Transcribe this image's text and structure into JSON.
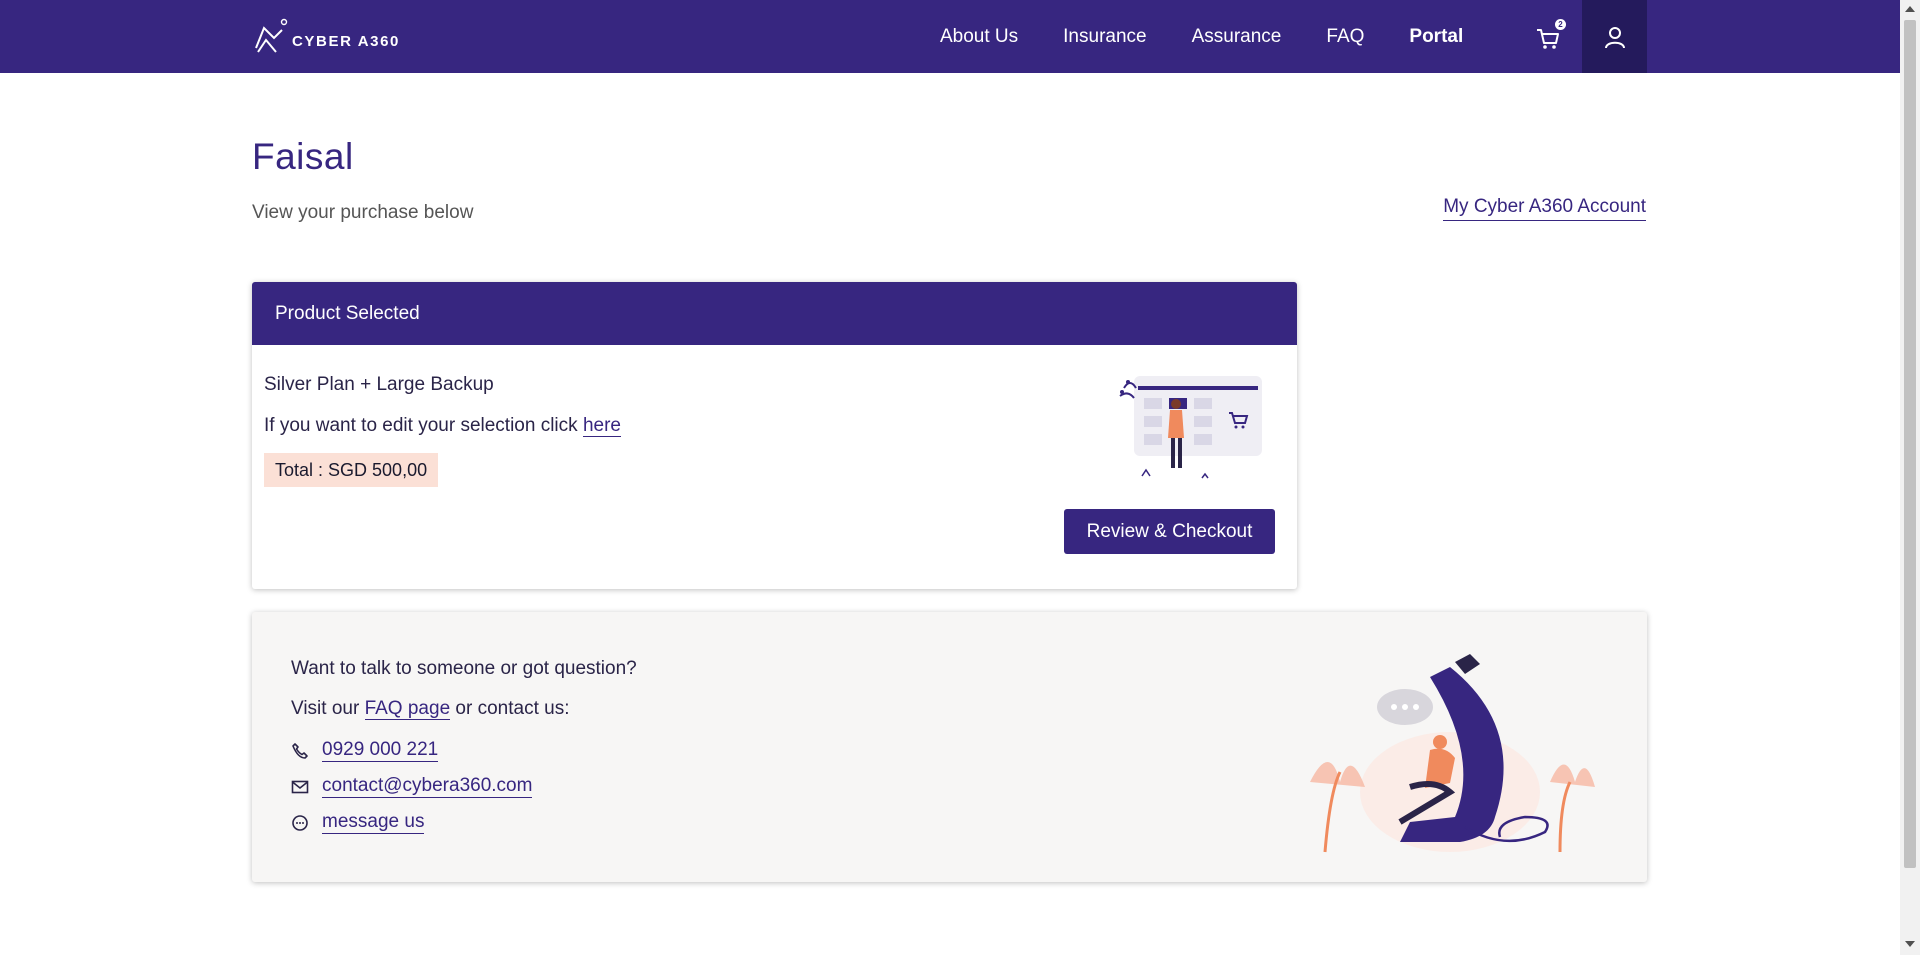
{
  "brand": {
    "name": "CYBER A360",
    "primary_color": "#372680",
    "accent_color": "#fbe0d6"
  },
  "nav": {
    "links": [
      {
        "label": "About Us",
        "active": false
      },
      {
        "label": "Insurance",
        "active": false
      },
      {
        "label": "Assurance",
        "active": false
      },
      {
        "label": "FAQ",
        "active": false
      },
      {
        "label": "Portal",
        "active": true
      }
    ],
    "cart_count": "2",
    "cart_icon": "cart-icon",
    "user_icon": "user-icon"
  },
  "header": {
    "greeting": "Faisal",
    "subtitle": "View your purchase below",
    "account_link": "My Cyber A360 Account"
  },
  "product": {
    "header": "Product Selected",
    "plan": "Silver Plan + Large Backup",
    "edit_prefix": "If you want to edit your selection click ",
    "edit_link": "here",
    "total": "Total : SGD 500,00",
    "checkout_label": "Review & Checkout"
  },
  "contact": {
    "question": "Want to talk to someone or got question?",
    "visit_prefix": "Visit our ",
    "faq_link": "FAQ page",
    "visit_suffix": " or contact us:",
    "items": [
      {
        "icon": "phone-icon",
        "label": "0929 000 221"
      },
      {
        "icon": "mail-icon",
        "label": "contact@cybera360.com"
      },
      {
        "icon": "chat-icon",
        "label": "message us"
      }
    ]
  }
}
